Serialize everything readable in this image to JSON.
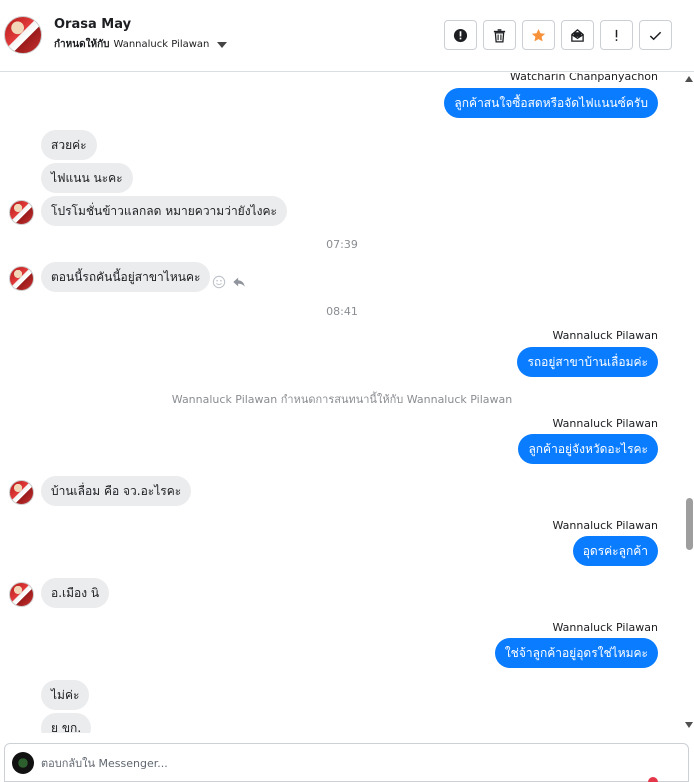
{
  "header": {
    "contact_name": "Orasa May",
    "assign_prefix": "กำหนดให้กับ",
    "assignee": "Wannaluck Pilawan",
    "actions": [
      {
        "name": "report-spam-button",
        "icon": "alert-circle-icon"
      },
      {
        "name": "delete-button",
        "icon": "trash-icon"
      },
      {
        "name": "star-button",
        "icon": "star-icon"
      },
      {
        "name": "mark-unread-button",
        "icon": "mail-icon"
      },
      {
        "name": "follow-up-button",
        "icon": "exclamation-icon"
      },
      {
        "name": "mark-done-button",
        "icon": "check-icon"
      }
    ]
  },
  "conversation": {
    "items": [
      {
        "type": "sender",
        "text": "Watcharin Chanpanyachon"
      },
      {
        "type": "out",
        "text": "ลูกค้าสนใจซื้อสดหรือจัดไฟแนนซ์ครับ"
      },
      {
        "type": "in",
        "text": "สวยค่ะ"
      },
      {
        "type": "in",
        "text": "ไฟแนน นะคะ"
      },
      {
        "type": "in",
        "text": "โปรโมชั่นข้าวแลกลด หมายความว่ายังไงคะ"
      },
      {
        "type": "time",
        "text": "07:39"
      },
      {
        "type": "in",
        "text": "ตอนนี้รถคันนี้อยู่สาขาไหนคะ"
      },
      {
        "type": "time",
        "text": "08:41"
      },
      {
        "type": "sender",
        "text": "Wannaluck Pilawan"
      },
      {
        "type": "out",
        "text": "รถอยู่สาขาบ้านเลื่อมค่ะ"
      },
      {
        "type": "system",
        "text": "Wannaluck Pilawan กำหนดการสนทนานี้ให้กับ Wannaluck Pilawan"
      },
      {
        "type": "sender",
        "text": "Wannaluck Pilawan"
      },
      {
        "type": "out",
        "text": "ลูกค้าอยู่จังหวัดอะไรคะ"
      },
      {
        "type": "in",
        "text": "บ้านเลื่อม คือ จว.อะไรคะ"
      },
      {
        "type": "sender",
        "text": "Wannaluck Pilawan"
      },
      {
        "type": "out",
        "text": "อุดรค่ะลูกค้า"
      },
      {
        "type": "in",
        "text": "อ.เมือง นิ"
      },
      {
        "type": "sender",
        "text": "Wannaluck Pilawan"
      },
      {
        "type": "out",
        "text": "ใช่จ้าลูกค้าอยู่อุดรใช่ไหมคะ"
      },
      {
        "type": "in",
        "text": "ไม่ค่ะ"
      },
      {
        "type": "in",
        "text": "ย ขก."
      }
    ]
  },
  "reply": {
    "placeholder": "ตอบกลับใน Messenger..."
  },
  "colors": {
    "outgoing_bubble": "#0a7cff",
    "incoming_bubble": "#ebecee",
    "star": "#f7923a"
  }
}
